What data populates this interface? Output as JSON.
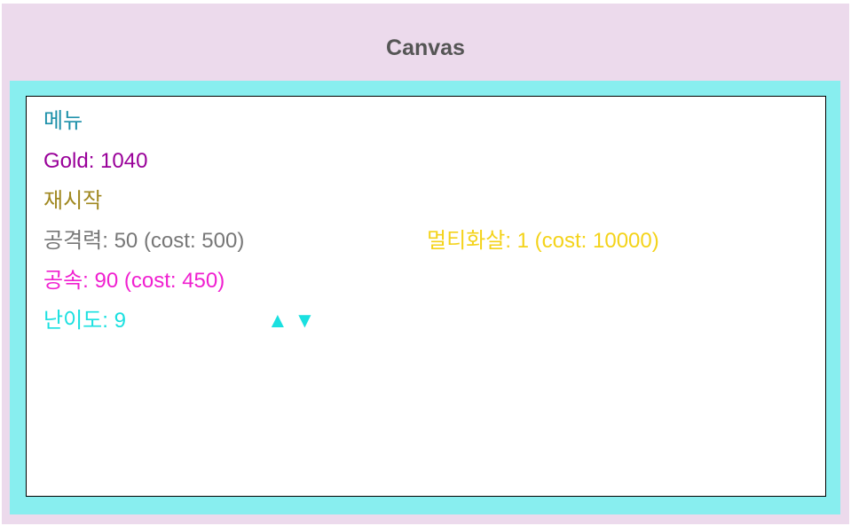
{
  "header": {
    "title": "Canvas"
  },
  "game": {
    "menu_label": "메뉴",
    "gold_text": "Gold: 1040",
    "restart_label": "재시작",
    "attack_text": "공격력: 50 (cost: 500)",
    "multishot_text": "멀티화살: 1 (cost: 10000)",
    "attack_speed_text": "공속: 90 (cost: 450)",
    "difficulty_text": "난이도: 9",
    "difficulty_up_label": "▲",
    "difficulty_down_label": "▼"
  },
  "colors": {
    "background": "#ecdaec",
    "frame": "#88eeef",
    "menu": "#1a8fa8",
    "gold": "#990099",
    "restart": "#a08820",
    "attack": "#777777",
    "multishot": "#f4d31a",
    "attack_speed": "#f020d0",
    "difficulty": "#1ae0e0"
  }
}
